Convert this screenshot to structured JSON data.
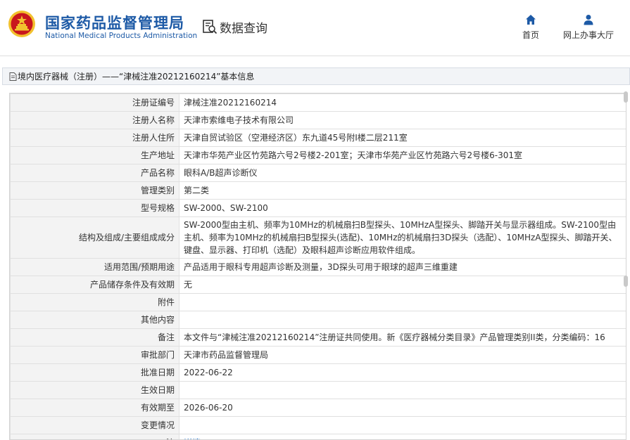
{
  "header": {
    "site_name_cn": "国家药品监督管理局",
    "site_name_en": "National Medical Products Administration",
    "section_title": "数据查询",
    "nav": [
      {
        "label": "首页",
        "icon": "home-icon"
      },
      {
        "label": "网上办事大厅",
        "icon": "user-icon"
      }
    ]
  },
  "breadcrumb": {
    "text": "境内医疗器械（注册）——“津械注准20212160214”基本信息"
  },
  "colors": {
    "brand_blue": "#1d5aa6",
    "emblem_red": "#c8161d",
    "emblem_gold": "#f2c12e",
    "link_blue": "#1d6fc9",
    "label_bg": "#f3f3f3"
  },
  "details": {
    "rows": [
      {
        "label": "注册证编号",
        "value": "津械注准20212160214"
      },
      {
        "label": "注册人名称",
        "value": "天津市索维电子技术有限公司"
      },
      {
        "label": "注册人住所",
        "value": "天津自贸试验区（空港经济区）东九道45号附I楼二层211室"
      },
      {
        "label": "生产地址",
        "value": "天津市华苑产业区竹苑路六号2号楼2-201室；天津市华苑产业区竹苑路六号2号楼6-301室"
      },
      {
        "label": "产品名称",
        "value": "眼科A/B超声诊断仪"
      },
      {
        "label": "管理类别",
        "value": "第二类"
      },
      {
        "label": "型号规格",
        "value": "SW-2000、SW-2100"
      },
      {
        "label": "结构及组成/主要组成成分",
        "value": "SW-2000型由主机、频率为10MHz的机械扇扫B型探头、10MHzA型探头、脚踏开关与显示器组成。SW-2100型由主机、频率为10MHz的机械扇扫B型探头(选配)、10MHz的机械扇扫3D探头（选配）、10MHzA型探头、脚踏开关、键盘、显示器、打印机（选配）及眼科超声诊断应用软件组成。"
      },
      {
        "label": "适用范围/预期用途",
        "value": "产品适用于眼科专用超声诊断及测量，3D探头可用于眼球的超声三维重建"
      },
      {
        "label": "产品储存条件及有效期",
        "value": "无"
      },
      {
        "label": "附件",
        "value": ""
      },
      {
        "label": "其他内容",
        "value": ""
      },
      {
        "label": "备注",
        "value": "本文件与“津械注准20212160214”注册证共同使用。新《医疗器械分类目录》产品管理类别II类，分类编码：16"
      },
      {
        "label": "审批部门",
        "value": "天津市药品监督管理局"
      },
      {
        "label": "批准日期",
        "value": "2022-06-22"
      },
      {
        "label": "生效日期",
        "value": ""
      },
      {
        "label": "有效期至",
        "value": "2026-06-20"
      },
      {
        "label": "变更情况",
        "value": ""
      },
      {
        "label": "注",
        "value": "详情"
      }
    ]
  }
}
